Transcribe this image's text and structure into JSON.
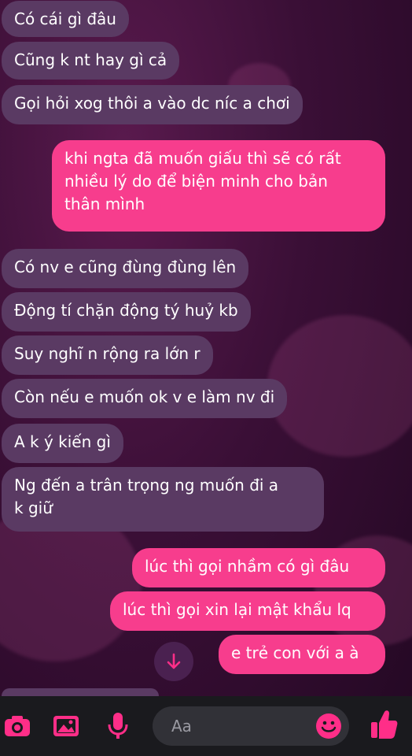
{
  "colors": {
    "incoming_bubble": "#5a3a63",
    "outgoing_bubble": "#f73d8d",
    "accent": "#ff2e88",
    "composer_bg": "#1a1a1e"
  },
  "messages": [
    {
      "side": "in",
      "text": "Có cái gì đâu"
    },
    {
      "side": "in",
      "text": "Cũng k nt hay gì cả"
    },
    {
      "side": "in",
      "text": "Gọi hỏi xog thôi a vào dc níc a chơi"
    },
    {
      "side": "out",
      "lines": [
        "khi ngta đã muốn giấu thì sẽ có rất",
        "nhiều lý do để biện minh cho bản",
        "thân mình"
      ]
    },
    {
      "side": "in",
      "text": "Có nv e cũng đùng đùng lên"
    },
    {
      "side": "in",
      "text": "Động tí chặn động tý huỷ kb"
    },
    {
      "side": "in",
      "text": "Suy nghĩ n rộng ra lớn r"
    },
    {
      "side": "in",
      "text": "Còn nếu e muốn ok v e làm nv đi"
    },
    {
      "side": "in",
      "text": "A k ý kiến gì"
    },
    {
      "side": "in",
      "lines": [
        "Ng đến a trân trọng ng muốn đi a",
        "k giữ"
      ]
    },
    {
      "side": "out",
      "text": "lúc thì gọi nhầm có gì đâu"
    },
    {
      "side": "out",
      "text": "lúc thì gọi xin lại mật khẩu lq"
    },
    {
      "side": "out",
      "text": "e trẻ con với a à"
    }
  ],
  "composer": {
    "placeholder": "Aa",
    "icons": [
      "camera-icon",
      "image-icon",
      "microphone-icon",
      "emoji-icon",
      "thumbs-up-icon"
    ]
  },
  "scroll_down_icon": "arrow-down-icon"
}
